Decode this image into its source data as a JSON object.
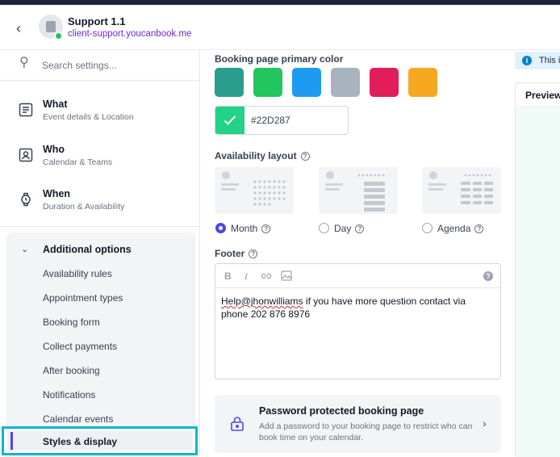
{
  "header": {
    "title": "Support 1.1",
    "subtitle": "client-support.youcanbook.me"
  },
  "sidebar": {
    "search_placeholder": "Search settings...",
    "items": [
      {
        "title": "What",
        "subtitle": "Event details & Location",
        "icon": "document-icon"
      },
      {
        "title": "Who",
        "subtitle": "Calendar & Teams",
        "icon": "person-icon"
      },
      {
        "title": "When",
        "subtitle": "Duration & Availability",
        "icon": "watch-icon"
      }
    ],
    "additional": {
      "label": "Additional options",
      "items": [
        "Availability rules",
        "Appointment types",
        "Booking form",
        "Collect payments",
        "After booking",
        "Notifications",
        "Calendar events"
      ],
      "active": "Styles & display"
    }
  },
  "main": {
    "color_title": "Booking page primary color",
    "swatches": [
      "#2a9d8f",
      "#22c55e",
      "#1d9bf0",
      "#a8b3bd",
      "#e11d5a",
      "#f7a823"
    ],
    "hex_value": "#22D287",
    "selected_color": "#22d287",
    "layout_title": "Availability layout",
    "layout_options": [
      "Month",
      "Day",
      "Agenda"
    ],
    "layout_selected": "Month",
    "footer_title": "Footer",
    "footer_text_link": "Help@jhonwilliams",
    "footer_text_rest": " if you have more question contact via phone 202 876 8976",
    "password": {
      "title": "Password protected booking page",
      "desc": "Add a password to your booking page to restrict who can book time on your calendar."
    }
  },
  "right": {
    "info": "This i",
    "preview": "Preview"
  },
  "colors": {
    "accent": "#4f46e5",
    "highlight": "#06b6d4",
    "link": "#6d28d9"
  }
}
